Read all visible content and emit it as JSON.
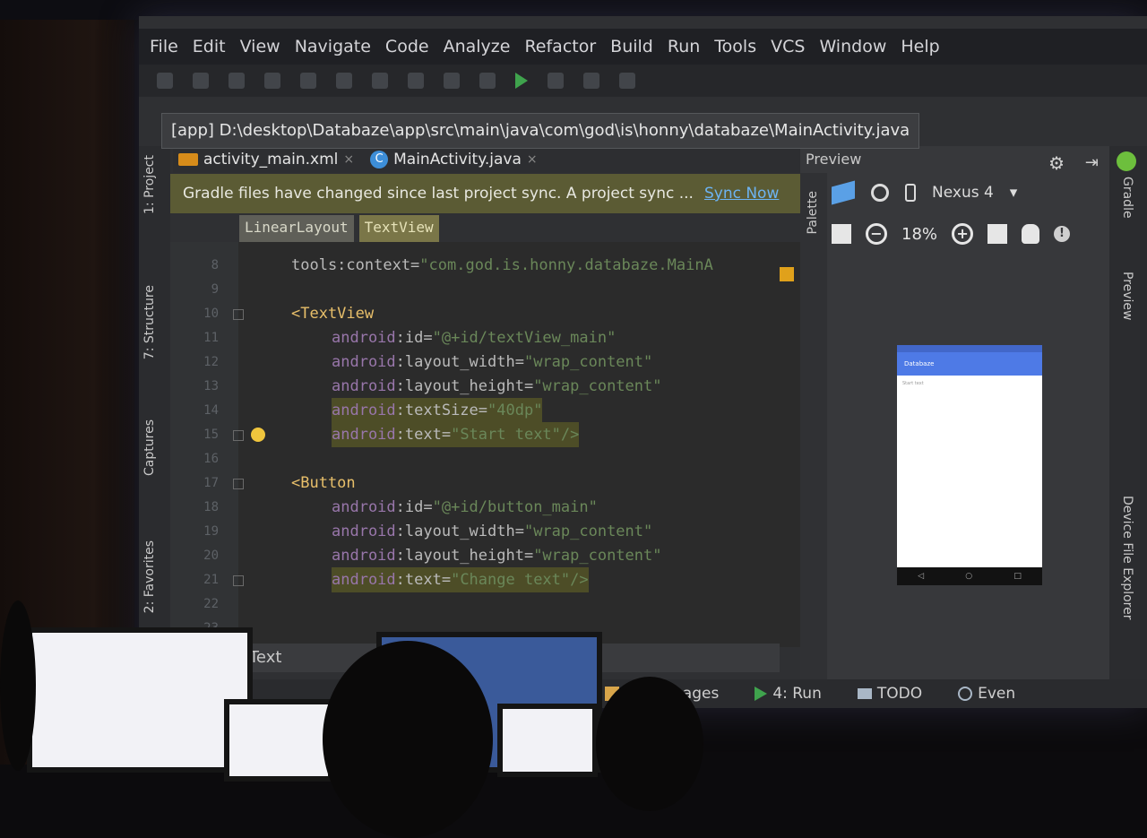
{
  "menu": [
    "File",
    "Edit",
    "View",
    "Navigate",
    "Code",
    "Analyze",
    "Refactor",
    "Build",
    "Run",
    "Tools",
    "VCS",
    "Window",
    "Help"
  ],
  "path_tooltip": "[app] D:\\desktop\\Databaze\\app\\src\\main\\java\\com\\god\\is\\honny\\databaze\\MainActivity.java",
  "tool_windows_left": {
    "project": "1: Project",
    "structure": "7: Structure",
    "captures": "Captures",
    "favorites": "2: Favorites"
  },
  "tabs": [
    {
      "label": "activity_main.xml"
    },
    {
      "label": "MainActivity.java",
      "icon_letter": "C"
    }
  ],
  "banner": {
    "message": "Gradle files have changed since last project sync. A project sync ...",
    "link": "Sync Now"
  },
  "breadcrumbs": [
    "LinearLayout",
    "TextView"
  ],
  "code_lines": [
    {
      "n": "8",
      "ns": "",
      "attr": "tools:context=",
      "val": "\"com.god.is.honny.databaze.MainA"
    },
    {
      "n": "9",
      "tag": ""
    },
    {
      "n": "10",
      "tag": "<TextView"
    },
    {
      "n": "11",
      "ns": "android",
      "attr": ":id=",
      "val": "\"@+id/textView_main\""
    },
    {
      "n": "12",
      "ns": "android",
      "attr": ":layout_width=",
      "val": "\"wrap_content\""
    },
    {
      "n": "13",
      "ns": "android",
      "attr": ":layout_height=",
      "val": "\"wrap_content\""
    },
    {
      "n": "14",
      "ns": "android",
      "attr": ":textSize=",
      "val": "\"40dp\""
    },
    {
      "n": "15",
      "ns": "android",
      "attr": ":text=",
      "val": "\"Start text\"/>"
    },
    {
      "n": "16",
      "tag": ""
    },
    {
      "n": "17",
      "tag": "<Button"
    },
    {
      "n": "18",
      "ns": "android",
      "attr": ":id=",
      "val": "\"@+id/button_main\""
    },
    {
      "n": "19",
      "ns": "android",
      "attr": ":layout_width=",
      "val": "\"wrap_content\""
    },
    {
      "n": "20",
      "ns": "android",
      "attr": ":layout_height=",
      "val": "\"wrap_content\""
    },
    {
      "n": "21",
      "ns": "android",
      "attr": ":text=",
      "val": "\"Change text\"/>"
    },
    {
      "n": "22",
      "tag": ""
    },
    {
      "n": "23",
      "tag": ""
    }
  ],
  "editor_mode_tab": "Text",
  "preview": {
    "title": "Preview",
    "palette": "Palette",
    "device": "Nexus 4",
    "zoom": "18%",
    "app_title": "Databaze",
    "app_text": "Start text"
  },
  "tool_windows_right": {
    "gradle": "Gradle",
    "preview": "Preview",
    "device_file_explorer": "Device File Explorer"
  },
  "statusbar": {
    "messages": "0: Messages",
    "run": "4: Run",
    "todo": "TODO",
    "event": "Even"
  }
}
